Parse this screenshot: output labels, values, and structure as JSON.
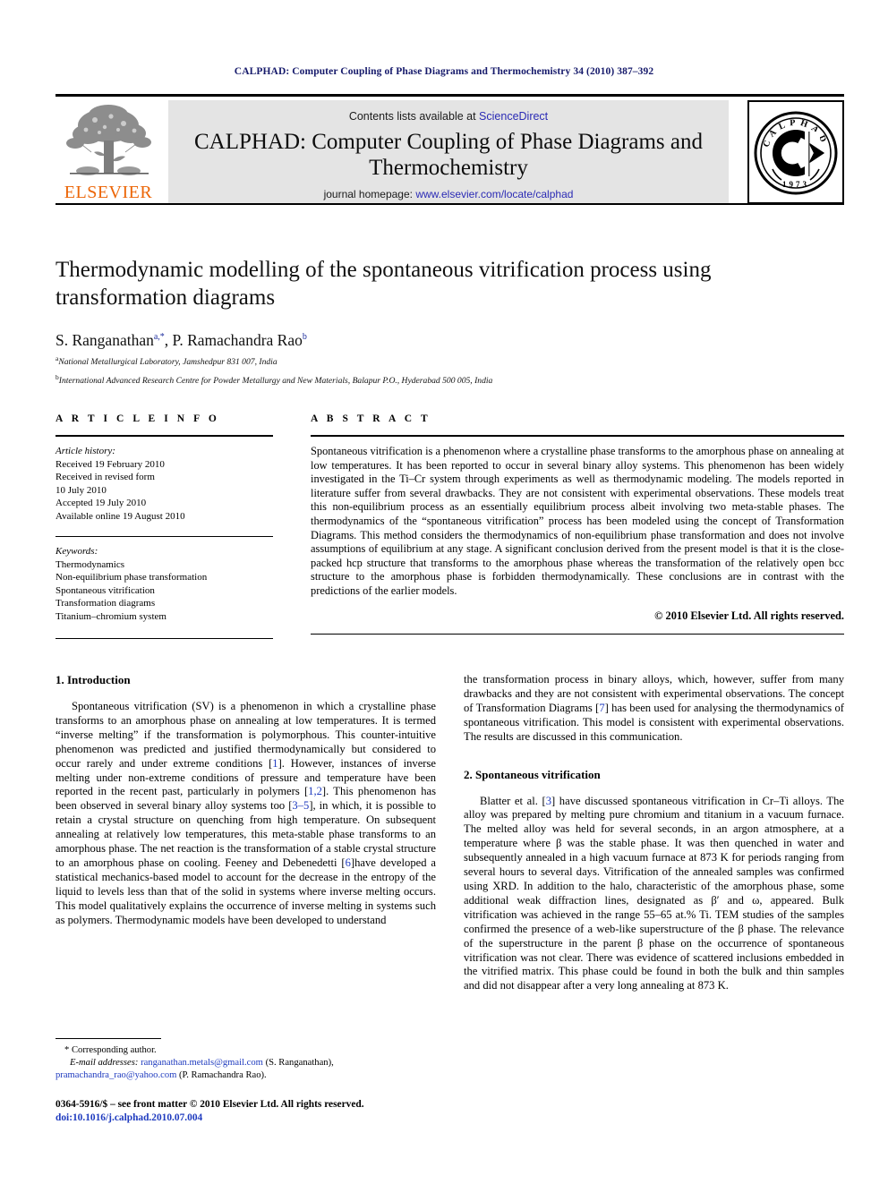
{
  "running_head": "CALPHAD: Computer Coupling of Phase Diagrams and Thermochemistry 34 (2010) 387–392",
  "masthead": {
    "publisher_name": "ELSEVIER",
    "contents_prefix": "Contents lists available at ",
    "contents_link": "ScienceDirect",
    "journal_title": "CALPHAD: Computer Coupling of Phase Diagrams and Thermochemistry",
    "homepage_prefix": "journal homepage: ",
    "homepage_url": "www.elsevier.com/locate/calphad",
    "logo_ring_text": "CALPHAD",
    "logo_year": "1973"
  },
  "title": "Thermodynamic modelling of the spontaneous vitrification process using transformation diagrams",
  "authors": {
    "author1_name": "S. Ranganathan",
    "author1_sup": "a,*",
    "separator": ", ",
    "author2_name": "P. Ramachandra Rao",
    "author2_sup": "b"
  },
  "affiliations": [
    {
      "marker": "a",
      "text": "National Metallurgical Laboratory, Jamshedpur 831 007, India"
    },
    {
      "marker": "b",
      "text": "International Advanced Research Centre for Powder Metallurgy and New Materials, Balapur P.O., Hyderabad 500 005, India"
    }
  ],
  "article_info": {
    "heading": "A R T I C L E    I N F O",
    "history_label": "Article history:",
    "history": [
      "Received 19 February 2010",
      "Received in revised form",
      "10 July 2010",
      "Accepted 19 July 2010",
      "Available online 19 August 2010"
    ],
    "keywords_label": "Keywords:",
    "keywords": [
      "Thermodynamics",
      "Non-equilibrium phase transformation",
      "Spontaneous vitrification",
      "Transformation diagrams",
      "Titanium–chromium system"
    ]
  },
  "abstract": {
    "heading": "A B S T R A C T",
    "text": "Spontaneous vitrification is a phenomenon where a crystalline phase transforms to the amorphous phase on annealing at low temperatures. It has been reported to occur in several binary alloy systems. This phenomenon has been widely investigated in the Ti–Cr system through experiments as well as thermodynamic modeling. The models reported in literature suffer from several drawbacks. They are not consistent with experimental observations. These models treat this non-equilibrium process as an essentially equilibrium process albeit involving two meta-stable phases. The thermodynamics of the “spontaneous vitrification” process has been modeled using the concept of Transformation Diagrams. This method considers the thermodynamics of non-equilibrium phase transformation and does not involve assumptions of equilibrium at any stage. A significant conclusion derived from the present model is that it is the close-packed hcp structure that transforms to the amorphous phase whereas the transformation of the relatively open bcc structure to the amorphous phase is forbidden thermodynamically. These conclusions are in contrast with the predictions of the earlier models.",
    "copyright": "© 2010 Elsevier Ltd. All rights reserved."
  },
  "body": {
    "section1_heading": "1. Introduction",
    "section1_para1_a": "Spontaneous vitrification (SV) is a phenomenon in which a crystalline phase transforms to an amorphous phase on annealing at low temperatures. It is termed “inverse melting” if the transformation is polymorphous. This counter-intuitive phenomenon was predicted and justified thermodynamically but considered to occur rarely and under extreme conditions [",
    "ref1": "1",
    "section1_para1_b": "]. However, instances of inverse melting under non-extreme conditions of pressure and temperature have been reported in the recent past, particularly in polymers [",
    "ref12": "1,2",
    "section1_para1_c": "]. This phenomenon has been observed in several binary alloy systems too [",
    "ref35": "3–5",
    "section1_para1_d": "], in which, it is possible to retain a crystal structure on quenching from high temperature. On subsequent annealing at relatively low temperatures, this meta-stable phase transforms to an amorphous phase. The net reaction is the transformation of a stable crystal structure to an amorphous phase on cooling. Feeney and Debenedetti [",
    "ref6": "6",
    "section1_para1_e": "]have developed a statistical mechanics-based model to account for the decrease in the entropy of the liquid to levels less than that of the solid in systems where inverse melting occurs. This model qualitatively explains the occurrence of inverse melting in systems such as polymers. Thermodynamic models have been developed to understand",
    "section1_para1_f": "the transformation process in binary alloys, which, however, suffer from many drawbacks and they are not consistent with experimental observations. The concept of Transformation Diagrams [",
    "ref7": "7",
    "section1_para1_g": "] has been used for analysing the thermodynamics of spontaneous vitrification. This model is consistent with experimental observations. The results are discussed in this communication.",
    "section2_heading": "2. Spontaneous vitrification",
    "section2_para1_a": "Blatter et al. [",
    "ref3": "3",
    "section2_para1_b": "] have discussed spontaneous vitrification in Cr–Ti alloys. The alloy was prepared by melting pure chromium and titanium in a vacuum furnace. The melted alloy was held for several seconds, in an argon atmosphere, at a temperature where β was the stable phase. It was then quenched in water and subsequently annealed in a high vacuum furnace at 873 K for periods ranging from several hours to several days. Vitrification of the annealed samples was confirmed using XRD. In addition to the halo, characteristic of the amorphous phase, some additional weak diffraction lines, designated as β′ and ω, appeared. Bulk vitrification was achieved in the range 55–65 at.% Ti. TEM studies of the samples confirmed the presence of a web-like superstructure of the β phase. The relevance of the superstructure in the parent β phase on the occurrence of spontaneous vitrification was not clear. There was evidence of scattered inclusions embedded in the vitrified matrix. This phase could be found in both the bulk and thin samples and did not disappear after a very long annealing at 873 K."
  },
  "footnote": {
    "corresponding_marker": "*",
    "corresponding_text": "Corresponding author.",
    "email_label": "E-mail addresses:",
    "email1": "ranganathan.metals@gmail.com",
    "email1_owner": "(S. Ranganathan),",
    "email2": "pramachandra_rao@yahoo.com",
    "email2_owner": "(P. Ramachandra Rao).",
    "issn_line": "0364-5916/$ – see front matter © 2010 Elsevier Ltd. All rights reserved.",
    "doi_line": "doi:10.1016/j.calphad.2010.07.004"
  },
  "colors": {
    "running_head": "#161a6b",
    "link": "#2b2bb5",
    "elsevier_orange": "#ec6608",
    "reference": "#1f3bbf",
    "band_bg": "#e4e4e4"
  }
}
